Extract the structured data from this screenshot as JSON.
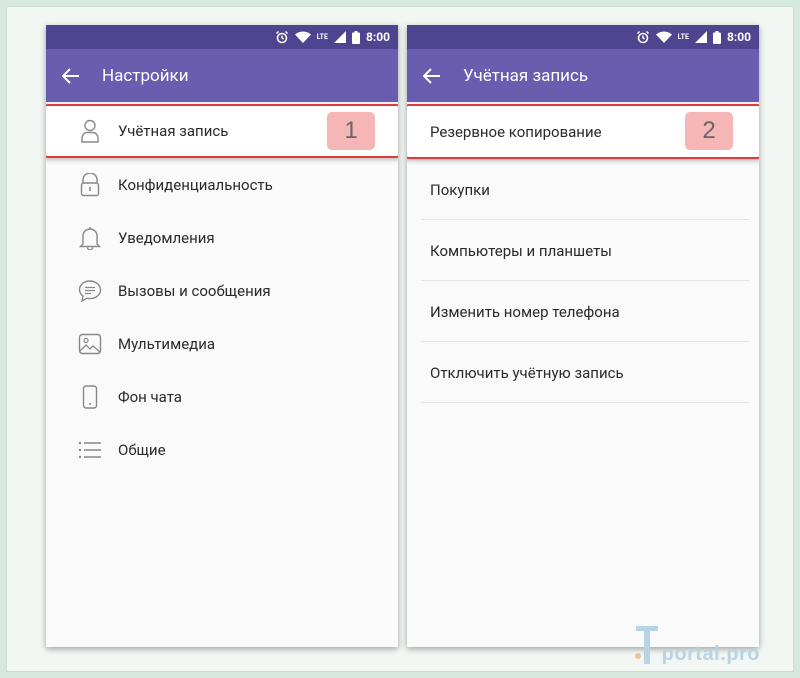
{
  "status": {
    "network": "LTE",
    "time": "8:00"
  },
  "left": {
    "title": "Настройки",
    "items": [
      {
        "label": "Учётная запись",
        "icon": "person-icon"
      },
      {
        "label": "Конфиденциальность",
        "icon": "lock-icon"
      },
      {
        "label": "Уведомления",
        "icon": "bell-icon"
      },
      {
        "label": "Вызовы и сообщения",
        "icon": "chat-icon"
      },
      {
        "label": "Мультимедиа",
        "icon": "image-icon"
      },
      {
        "label": "Фон чата",
        "icon": "phone-icon"
      },
      {
        "label": "Общие",
        "icon": "list-icon"
      }
    ],
    "badge": "1"
  },
  "right": {
    "title": "Учётная запись",
    "items": [
      {
        "label": "Резервное копирование"
      },
      {
        "label": "Покупки"
      },
      {
        "label": "Компьютеры и планшеты"
      },
      {
        "label": "Изменить номер телефона"
      },
      {
        "label": "Отключить учётную запись"
      }
    ],
    "badge": "2"
  },
  "watermark": {
    "text": "portal.pro"
  }
}
